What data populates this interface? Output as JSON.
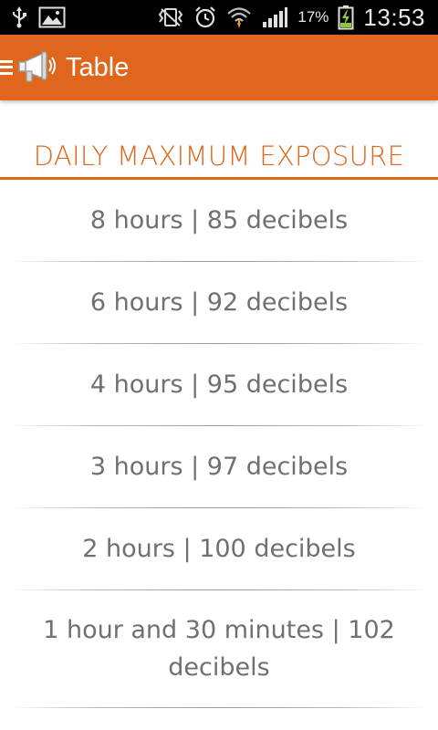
{
  "status_bar": {
    "icons": [
      "usb-icon",
      "image-icon",
      "vibrate-icon",
      "alarm-icon",
      "wifi-icon",
      "signal-icon",
      "battery-charging-icon"
    ],
    "battery_percent": "17%",
    "time": "13:53"
  },
  "action_bar": {
    "title": "Table",
    "background_color": "#e0651d",
    "icons": [
      "drawer-menu-icon",
      "megaphone-icon"
    ]
  },
  "content": {
    "section_title": "DAILY MAXIMUM EXPOSURE",
    "accent_color": "#e0651d",
    "rows": [
      "8 hours | 85 decibels",
      "6 hours | 92 decibels",
      "4 hours | 95 decibels",
      "3 hours | 97 decibels",
      "2 hours | 100 decibels",
      "1 hour and 30 minutes | 102 decibels"
    ]
  }
}
